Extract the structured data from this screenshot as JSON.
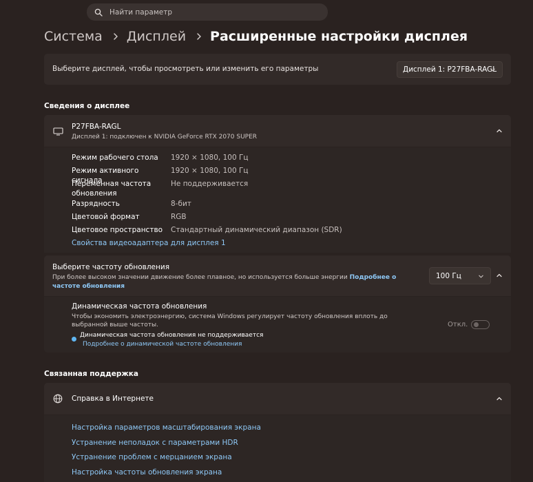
{
  "search": {
    "placeholder": "Найти параметр"
  },
  "breadcrumb": {
    "system": "Система",
    "display": "Дисплей",
    "current": "Расширенные настройки дисплея"
  },
  "display_selector": {
    "label": "Выберите дисплей, чтобы просмотреть или изменить его параметры",
    "selected": "Дисплей 1: P27FBA-RAGL"
  },
  "display_info": {
    "section_title": "Сведения о дисплее",
    "name": "P27FBA-RAGL",
    "subtitle": "Дисплей 1: подключен к NVIDIA GeForce RTX 2070 SUPER",
    "rows": [
      {
        "label": "Режим рабочего стола",
        "value": "1920 × 1080, 100 Гц"
      },
      {
        "label": "Режим активного сигнала",
        "value": "1920 × 1080, 100 Гц"
      },
      {
        "label": "Переменная частота обновления",
        "value": "Не поддерживается"
      },
      {
        "label": "Разрядность",
        "value": "8-бит"
      },
      {
        "label": "Цветовой формат",
        "value": "RGB"
      },
      {
        "label": "Цветовое пространство",
        "value": "Стандартный динамический диапазон (SDR)"
      }
    ],
    "adapter_link": "Свойства видеоадаптера для дисплея 1"
  },
  "refresh_rate": {
    "title": "Выберите частоту обновления",
    "description": "При более высоком значении движение более плавное, но используется больше энергии",
    "learn_more": "Подробнее о частоте обновления",
    "selected": "100 Гц"
  },
  "dynamic_refresh": {
    "title": "Динамическая частота обновления",
    "description": "Чтобы экономить электроэнергию, система Windows регулирует частоту обновления вплоть до выбранной выше частоты.",
    "warning": "Динамическая частота обновления не поддерживается",
    "link": "Подробнее о динамической частоте обновления",
    "toggle_label": "Откл.",
    "enabled": false
  },
  "related_support": {
    "section_title": "Связанная поддержка",
    "help_title": "Справка в Интернете",
    "links": [
      "Настройка параметров масштабирования экрана",
      "Устранение неполадок с параметрами HDR",
      "Устранение проблем с мерцанием экрана",
      "Настройка частоты обновления экрана"
    ]
  },
  "colors": {
    "background": "#2a2220",
    "card": "#322a28",
    "accent": "#8ec8f6",
    "dot": "#60b6f2"
  },
  "icons": [
    "search-icon",
    "chevron-right-icon",
    "chevron-down-icon",
    "chevron-up-icon",
    "monitor-icon",
    "globe-icon"
  ]
}
